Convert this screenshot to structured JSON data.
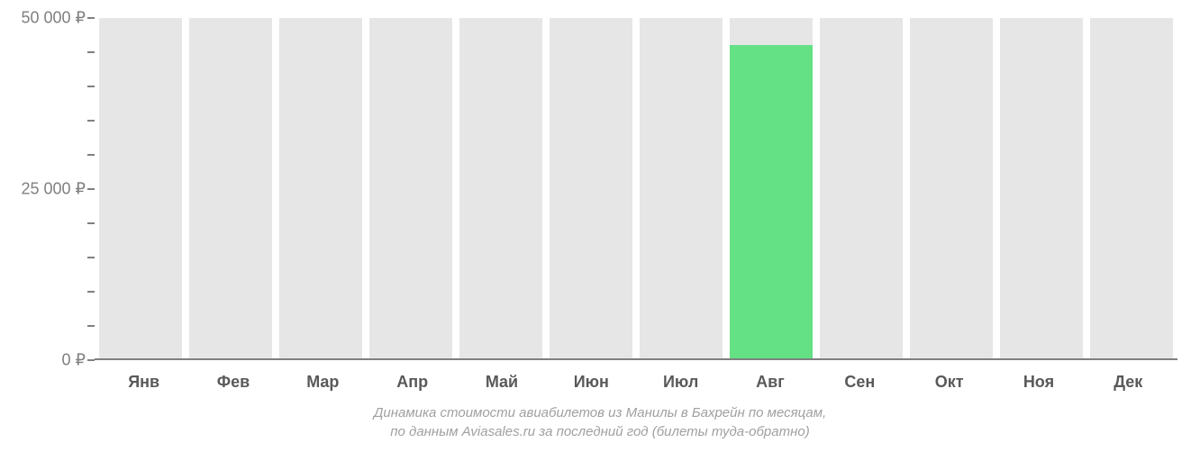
{
  "chart_data": {
    "type": "bar",
    "categories": [
      "Янв",
      "Фев",
      "Мар",
      "Апр",
      "Май",
      "Июн",
      "Июл",
      "Авг",
      "Сен",
      "Окт",
      "Ноя",
      "Дек"
    ],
    "values": [
      null,
      null,
      null,
      null,
      null,
      null,
      null,
      46000,
      null,
      null,
      null,
      null
    ],
    "title": "Динамика стоимости авиабилетов из Манилы в Бахрейн по месяцам,",
    "subtitle": "по данным Aviasales.ru за последний год (билеты туда-обратно)",
    "xlabel": "",
    "ylabel": "",
    "ylim": [
      0,
      50000
    ],
    "currency": "₽",
    "y_major_ticks": [
      0,
      25000,
      50000
    ],
    "y_minor_tick_step": 5000,
    "bar_color": "#64e085",
    "placeholder_color": "#e6e6e6"
  },
  "y_labels": {
    "l0": "0 ₽",
    "l1": "25 000 ₽",
    "l2": "50 000 ₽"
  }
}
